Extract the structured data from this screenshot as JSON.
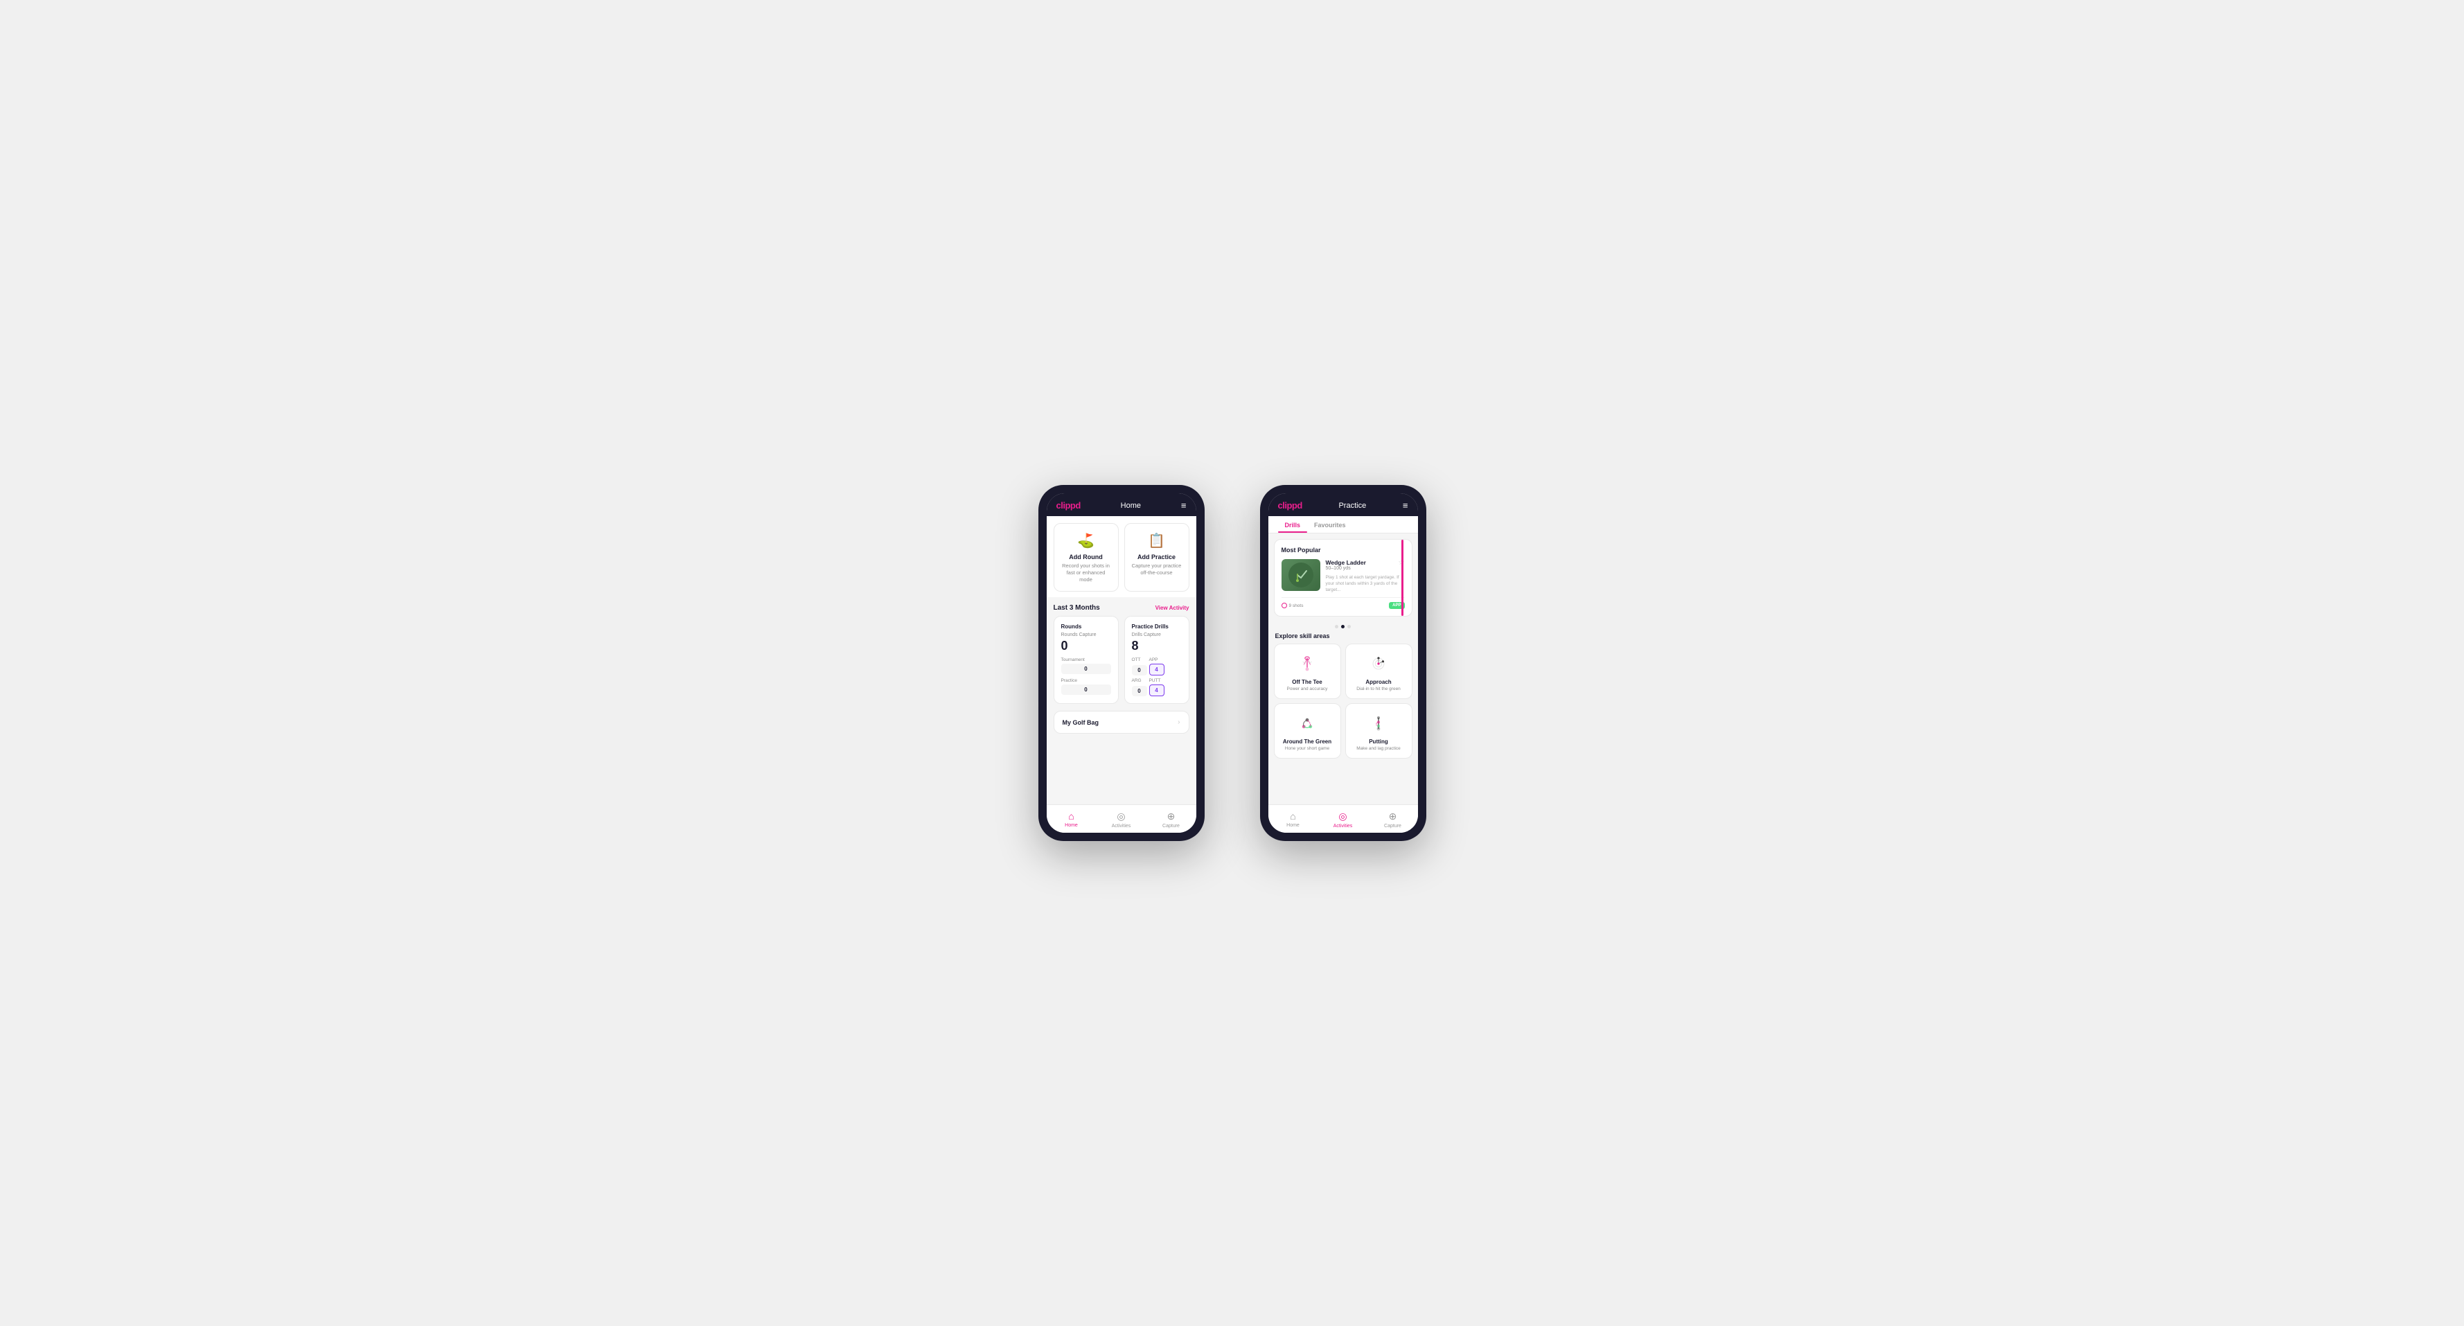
{
  "phone1": {
    "header": {
      "logo": "clippd",
      "title": "Home",
      "menu_icon": "≡"
    },
    "action_cards": [
      {
        "id": "add-round",
        "icon": "⛳",
        "title": "Add Round",
        "subtitle": "Record your shots in fast or enhanced mode"
      },
      {
        "id": "add-practice",
        "icon": "📋",
        "title": "Add Practice",
        "subtitle": "Capture your practice off-the-course"
      }
    ],
    "activity_section": {
      "title": "Last 3 Months",
      "link": "View Activity"
    },
    "rounds_card": {
      "title": "Rounds",
      "capture_label": "Rounds Capture",
      "total": "0",
      "rows": [
        {
          "label": "Tournament",
          "value": "0"
        },
        {
          "label": "Practice",
          "value": "0"
        }
      ]
    },
    "drills_card": {
      "title": "Practice Drills",
      "capture_label": "Drills Capture",
      "total": "8",
      "labels": [
        "OTT",
        "APP",
        "ARG",
        "PUTT"
      ],
      "values": [
        "0",
        "4",
        "0",
        "4"
      ],
      "highlighted_indices": [
        1,
        3
      ]
    },
    "golf_bag": {
      "label": "My Golf Bag"
    },
    "nav": {
      "items": [
        {
          "id": "home",
          "icon": "⌂",
          "label": "Home",
          "active": true
        },
        {
          "id": "activities",
          "icon": "◎",
          "label": "Activities",
          "active": false
        },
        {
          "id": "capture",
          "icon": "⊕",
          "label": "Capture",
          "active": false
        }
      ]
    }
  },
  "phone2": {
    "header": {
      "logo": "clippd",
      "title": "Practice",
      "menu_icon": "≡"
    },
    "tabs": [
      {
        "id": "drills",
        "label": "Drills",
        "active": true
      },
      {
        "id": "favourites",
        "label": "Favourites",
        "active": false
      }
    ],
    "most_popular": {
      "title": "Most Popular",
      "drill": {
        "title": "Wedge Ladder",
        "distance": "50–100 yds",
        "description": "Play 1 shot at each target yardage. If your shot lands within 3 yards of the target...",
        "shots": "9 shots",
        "badge": "APP"
      },
      "dots": [
        {
          "active": false
        },
        {
          "active": true
        },
        {
          "active": false
        }
      ]
    },
    "explore": {
      "title": "Explore skill areas",
      "skills": [
        {
          "id": "off-the-tee",
          "title": "Off The Tee",
          "subtitle": "Power and accuracy",
          "icon_type": "tee"
        },
        {
          "id": "approach",
          "title": "Approach",
          "subtitle": "Dial-in to hit the green",
          "icon_type": "approach"
        },
        {
          "id": "around-the-green",
          "title": "Around The Green",
          "subtitle": "Hone your short game",
          "icon_type": "around"
        },
        {
          "id": "putting",
          "title": "Putting",
          "subtitle": "Make and lag practice",
          "icon_type": "putting"
        }
      ]
    },
    "nav": {
      "items": [
        {
          "id": "home",
          "icon": "⌂",
          "label": "Home",
          "active": false
        },
        {
          "id": "activities",
          "icon": "◎",
          "label": "Activities",
          "active": true
        },
        {
          "id": "capture",
          "icon": "⊕",
          "label": "Capture",
          "active": false
        }
      ]
    }
  }
}
